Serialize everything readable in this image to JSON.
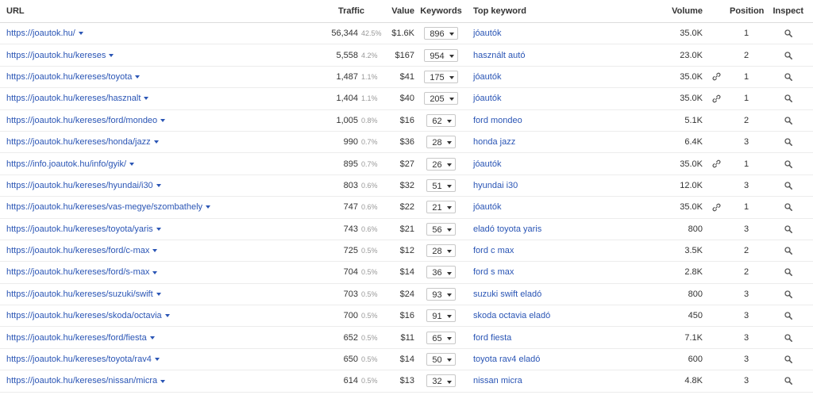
{
  "headers": {
    "url": "URL",
    "traffic": "Traffic",
    "value": "Value",
    "keywords": "Keywords",
    "top_keyword": "Top keyword",
    "volume": "Volume",
    "position": "Position",
    "inspect": "Inspect"
  },
  "colors": {
    "link": "#2a55b5",
    "muted": "#999999",
    "border": "#ececec"
  },
  "rows": [
    {
      "url": "https://joautok.hu/",
      "traffic": "56,344",
      "pct": "42.5%",
      "value": "$1.6K",
      "keywords": "896",
      "top": "jóautók",
      "volume": "35.0K",
      "link": false,
      "position": "1"
    },
    {
      "url": "https://joautok.hu/kereses",
      "traffic": "5,558",
      "pct": "4.2%",
      "value": "$167",
      "keywords": "954",
      "top": "használt autó",
      "volume": "23.0K",
      "link": false,
      "position": "2"
    },
    {
      "url": "https://joautok.hu/kereses/toyota",
      "traffic": "1,487",
      "pct": "1.1%",
      "value": "$41",
      "keywords": "175",
      "top": "jóautók",
      "volume": "35.0K",
      "link": true,
      "position": "1"
    },
    {
      "url": "https://joautok.hu/kereses/hasznalt",
      "traffic": "1,404",
      "pct": "1.1%",
      "value": "$40",
      "keywords": "205",
      "top": "jóautók",
      "volume": "35.0K",
      "link": true,
      "position": "1"
    },
    {
      "url": "https://joautok.hu/kereses/ford/mondeo",
      "traffic": "1,005",
      "pct": "0.8%",
      "value": "$16",
      "keywords": "62",
      "top": "ford mondeo",
      "volume": "5.1K",
      "link": false,
      "position": "2"
    },
    {
      "url": "https://joautok.hu/kereses/honda/jazz",
      "traffic": "990",
      "pct": "0.7%",
      "value": "$36",
      "keywords": "28",
      "top": "honda jazz",
      "volume": "6.4K",
      "link": false,
      "position": "3"
    },
    {
      "url": "https://info.joautok.hu/info/gyik/",
      "traffic": "895",
      "pct": "0.7%",
      "value": "$27",
      "keywords": "26",
      "top": "jóautók",
      "volume": "35.0K",
      "link": true,
      "position": "1"
    },
    {
      "url": "https://joautok.hu/kereses/hyundai/i30",
      "traffic": "803",
      "pct": "0.6%",
      "value": "$32",
      "keywords": "51",
      "top": "hyundai i30",
      "volume": "12.0K",
      "link": false,
      "position": "3"
    },
    {
      "url": "https://joautok.hu/kereses/vas-megye/szombathely",
      "traffic": "747",
      "pct": "0.6%",
      "value": "$22",
      "keywords": "21",
      "top": "jóautók",
      "volume": "35.0K",
      "link": true,
      "position": "1"
    },
    {
      "url": "https://joautok.hu/kereses/toyota/yaris",
      "traffic": "743",
      "pct": "0.6%",
      "value": "$21",
      "keywords": "56",
      "top": "eladó toyota yaris",
      "volume": "800",
      "link": false,
      "position": "3"
    },
    {
      "url": "https://joautok.hu/kereses/ford/c-max",
      "traffic": "725",
      "pct": "0.5%",
      "value": "$12",
      "keywords": "28",
      "top": "ford c max",
      "volume": "3.5K",
      "link": false,
      "position": "2"
    },
    {
      "url": "https://joautok.hu/kereses/ford/s-max",
      "traffic": "704",
      "pct": "0.5%",
      "value": "$14",
      "keywords": "36",
      "top": "ford s max",
      "volume": "2.8K",
      "link": false,
      "position": "2"
    },
    {
      "url": "https://joautok.hu/kereses/suzuki/swift",
      "traffic": "703",
      "pct": "0.5%",
      "value": "$24",
      "keywords": "93",
      "top": "suzuki swift eladó",
      "volume": "800",
      "link": false,
      "position": "3"
    },
    {
      "url": "https://joautok.hu/kereses/skoda/octavia",
      "traffic": "700",
      "pct": "0.5%",
      "value": "$16",
      "keywords": "91",
      "top": "skoda octavia eladó",
      "volume": "450",
      "link": false,
      "position": "3"
    },
    {
      "url": "https://joautok.hu/kereses/ford/fiesta",
      "traffic": "652",
      "pct": "0.5%",
      "value": "$11",
      "keywords": "65",
      "top": "ford fiesta",
      "volume": "7.1K",
      "link": false,
      "position": "3"
    },
    {
      "url": "https://joautok.hu/kereses/toyota/rav4",
      "traffic": "650",
      "pct": "0.5%",
      "value": "$14",
      "keywords": "50",
      "top": "toyota rav4 eladó",
      "volume": "600",
      "link": false,
      "position": "3"
    },
    {
      "url": "https://joautok.hu/kereses/nissan/micra",
      "traffic": "614",
      "pct": "0.5%",
      "value": "$13",
      "keywords": "32",
      "top": "nissan micra",
      "volume": "4.8K",
      "link": false,
      "position": "3"
    }
  ]
}
